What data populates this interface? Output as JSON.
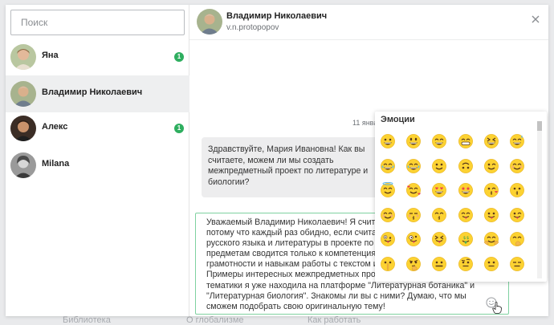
{
  "background": {
    "footer_links": [
      "Библиотека",
      "О глобализме",
      "Как работать"
    ]
  },
  "search": {
    "placeholder": "Поиск",
    "value": ""
  },
  "contacts": [
    {
      "name": "Яна",
      "badge": "1",
      "active": false
    },
    {
      "name": "Владимир Николаевич",
      "badge": "",
      "active": true
    },
    {
      "name": "Алекс",
      "badge": "1",
      "active": false
    },
    {
      "name": "Milana",
      "badge": "",
      "active": false
    }
  ],
  "chat": {
    "header_name": "Владимир Николаевич",
    "header_login": "v.n.protopopov",
    "date_separator": "11 янва",
    "incoming_message": "Здравствуйте, Мария Ивановна! Как вы\nсчитаете, можем ли мы создать\nмежпредметный проект по литературе и\nбиологии?",
    "compose_text": "Уважаемый Владимир Николаевич! Я счита\nпотому что каждый раз обидно, если счита\nрусского языка и литературы в проекте по\nпредметам сводится только к компетенция\nграмотности и навыкам работы с текстом и\nПримеры интересных межпредметных про\nтематики я уже находила на платформе \"Литературная ботаника\" и\n\"Литературная биология\". Знакомы ли вы с ними? Думаю, что мы\nсможем подобрать свою оригинальную тему!"
  },
  "emoji_panel": {
    "title": "Эмоции",
    "emojis": [
      "grinning",
      "smiley",
      "smile",
      "grin",
      "laughing",
      "sweat_smile",
      "rofl",
      "joy",
      "slightly_smiling",
      "upside_down",
      "wink",
      "blush",
      "innocent",
      "smiling_hearts",
      "heart_eyes",
      "star_struck",
      "kissing_heart",
      "kissing",
      "relaxed",
      "kissing_closed_eyes",
      "kissing_smiling_eyes",
      "yum",
      "tongue",
      "winking_tongue",
      "zany",
      "crazy",
      "squinting_tongue",
      "money_mouth",
      "hugging",
      "hand_over_mouth",
      "shushing",
      "thinking",
      "zipper_mouth",
      "raised_eyebrow",
      "neutral",
      "expressionless"
    ]
  },
  "colors": {
    "accent": "#2eae5f",
    "emoji_face": "#fcd232"
  }
}
